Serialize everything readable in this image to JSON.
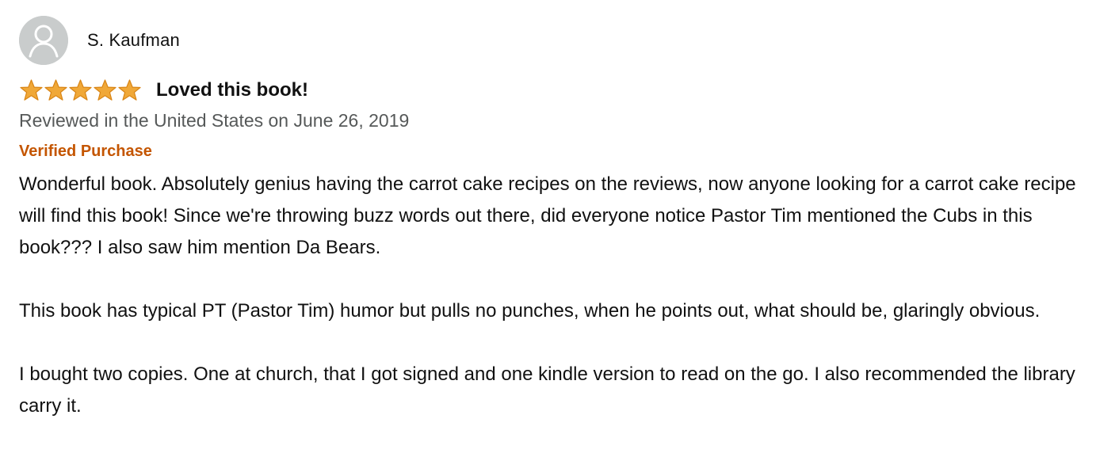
{
  "review": {
    "reviewer": {
      "name": "S. Kaufman",
      "avatar_icon": "default-user-avatar-icon"
    },
    "rating": {
      "value": 5,
      "max": 5,
      "star_color": "#f0a838"
    },
    "title": "Loved this book!",
    "date": "Reviewed in the United States on June 26, 2019",
    "verified_purchase": "Verified Purchase",
    "paragraphs": [
      "Wonderful book. Absolutely genius having the carrot cake recipes on the reviews, now anyone looking for a carrot cake recipe will find this book! Since we're throwing buzz words out there, did everyone notice Pastor Tim mentioned the Cubs in this book??? I also saw him mention Da Bears.",
      "This book has typical PT (Pastor Tim) humor but pulls no punches, when he points out, what should be, glaringly obvious.",
      "I bought two copies. One at church, that I got signed and one kindle version to read on the go. I also recommended the library carry it."
    ]
  },
  "colors": {
    "verified": "#c45500",
    "secondary_text": "#565959",
    "avatar_bg": "#c9cccc"
  }
}
